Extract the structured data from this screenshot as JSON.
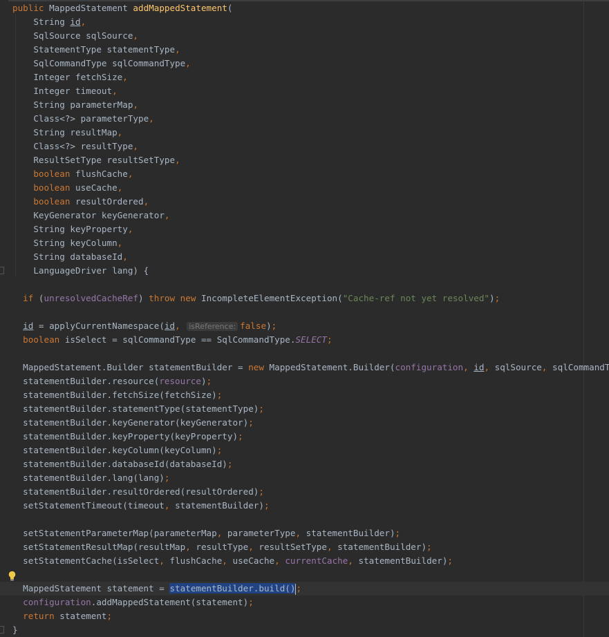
{
  "editor": {
    "lines": [
      {
        "indent": 0,
        "t": [
          [
            "kw",
            "public "
          ],
          [
            "",
            "MappedStatement "
          ],
          [
            "fn",
            "addMappedStatement"
          ],
          [
            "",
            "("
          ]
        ]
      },
      {
        "indent": 2,
        "t": [
          [
            "",
            "String "
          ],
          [
            "ul",
            "id"
          ],
          [
            "kw",
            ","
          ]
        ]
      },
      {
        "indent": 2,
        "t": [
          [
            "",
            "SqlSource sqlSource"
          ],
          [
            "kw",
            ","
          ]
        ]
      },
      {
        "indent": 2,
        "t": [
          [
            "",
            "StatementType statementType"
          ],
          [
            "kw",
            ","
          ]
        ]
      },
      {
        "indent": 2,
        "t": [
          [
            "",
            "SqlCommandType sqlCommandType"
          ],
          [
            "kw",
            ","
          ]
        ]
      },
      {
        "indent": 2,
        "t": [
          [
            "",
            "Integer fetchSize"
          ],
          [
            "kw",
            ","
          ]
        ]
      },
      {
        "indent": 2,
        "t": [
          [
            "",
            "Integer timeout"
          ],
          [
            "kw",
            ","
          ]
        ]
      },
      {
        "indent": 2,
        "t": [
          [
            "",
            "String parameterMap"
          ],
          [
            "kw",
            ","
          ]
        ]
      },
      {
        "indent": 2,
        "t": [
          [
            "",
            "Class<?> parameterType"
          ],
          [
            "kw",
            ","
          ]
        ]
      },
      {
        "indent": 2,
        "t": [
          [
            "",
            "String resultMap"
          ],
          [
            "kw",
            ","
          ]
        ]
      },
      {
        "indent": 2,
        "t": [
          [
            "",
            "Class<?> resultType"
          ],
          [
            "kw",
            ","
          ]
        ]
      },
      {
        "indent": 2,
        "t": [
          [
            "",
            "ResultSetType resultSetType"
          ],
          [
            "kw",
            ","
          ]
        ]
      },
      {
        "indent": 2,
        "t": [
          [
            "kw",
            "boolean "
          ],
          [
            "",
            "flushCache"
          ],
          [
            "kw",
            ","
          ]
        ]
      },
      {
        "indent": 2,
        "t": [
          [
            "kw",
            "boolean "
          ],
          [
            "",
            "useCache"
          ],
          [
            "kw",
            ","
          ]
        ]
      },
      {
        "indent": 2,
        "t": [
          [
            "kw",
            "boolean "
          ],
          [
            "",
            "resultOrdered"
          ],
          [
            "kw",
            ","
          ]
        ]
      },
      {
        "indent": 2,
        "t": [
          [
            "",
            "KeyGenerator keyGenerator"
          ],
          [
            "kw",
            ","
          ]
        ]
      },
      {
        "indent": 2,
        "t": [
          [
            "",
            "String keyProperty"
          ],
          [
            "kw",
            ","
          ]
        ]
      },
      {
        "indent": 2,
        "t": [
          [
            "",
            "String keyColumn"
          ],
          [
            "kw",
            ","
          ]
        ]
      },
      {
        "indent": 2,
        "t": [
          [
            "",
            "String databaseId"
          ],
          [
            "kw",
            ","
          ]
        ]
      },
      {
        "indent": 2,
        "t": [
          [
            "",
            "LanguageDriver lang) {"
          ]
        ]
      },
      {
        "indent": 0,
        "t": []
      },
      {
        "indent": 1,
        "t": [
          [
            "kw",
            "if "
          ],
          [
            "",
            "("
          ],
          [
            "fld",
            "unresolvedCacheRef"
          ],
          [
            "",
            ") "
          ],
          [
            "kw",
            "throw new "
          ],
          [
            "",
            "IncompleteElementException("
          ],
          [
            "str",
            "\"Cache-ref not yet resolved\""
          ],
          [
            "",
            ")"
          ],
          [
            "kw",
            ";"
          ]
        ]
      },
      {
        "indent": 0,
        "t": []
      },
      {
        "indent": 1,
        "t": [
          [
            "ul",
            "id"
          ],
          [
            "",
            " = applyCurrentNamespace("
          ],
          [
            "ul",
            "id"
          ],
          [
            "kw",
            ", "
          ],
          [
            "hint",
            "isReference:"
          ],
          [
            "kw",
            "false"
          ],
          [
            "",
            ")"
          ],
          [
            "kw",
            ";"
          ]
        ]
      },
      {
        "indent": 1,
        "t": [
          [
            "kw",
            "boolean "
          ],
          [
            "",
            "isSelect = sqlCommandType == SqlCommandType."
          ],
          [
            "stat",
            "SELECT"
          ],
          [
            "kw",
            ";"
          ]
        ]
      },
      {
        "indent": 0,
        "t": []
      },
      {
        "indent": 1,
        "t": [
          [
            "",
            "MappedStatement.Builder statementBuilder = "
          ],
          [
            "kw",
            "new "
          ],
          [
            "",
            "MappedStatement.Builder("
          ],
          [
            "fld",
            "configuration"
          ],
          [
            "kw",
            ", "
          ],
          [
            "ul",
            "id"
          ],
          [
            "kw",
            ", "
          ],
          [
            "",
            "sqlSource"
          ],
          [
            "kw",
            ", "
          ],
          [
            "",
            "sqlCommandType)"
          ],
          [
            "kw",
            ";"
          ]
        ]
      },
      {
        "indent": 1,
        "t": [
          [
            "",
            "statementBuilder.resource("
          ],
          [
            "fld",
            "resource"
          ],
          [
            "",
            ")"
          ],
          [
            "kw",
            ";"
          ]
        ]
      },
      {
        "indent": 1,
        "t": [
          [
            "",
            "statementBuilder.fetchSize(fetchSize)"
          ],
          [
            "kw",
            ";"
          ]
        ]
      },
      {
        "indent": 1,
        "t": [
          [
            "",
            "statementBuilder.statementType(statementType)"
          ],
          [
            "kw",
            ";"
          ]
        ]
      },
      {
        "indent": 1,
        "t": [
          [
            "",
            "statementBuilder.keyGenerator(keyGenerator)"
          ],
          [
            "kw",
            ";"
          ]
        ]
      },
      {
        "indent": 1,
        "t": [
          [
            "",
            "statementBuilder.keyProperty(keyProperty)"
          ],
          [
            "kw",
            ";"
          ]
        ]
      },
      {
        "indent": 1,
        "t": [
          [
            "",
            "statementBuilder.keyColumn(keyColumn)"
          ],
          [
            "kw",
            ";"
          ]
        ]
      },
      {
        "indent": 1,
        "t": [
          [
            "",
            "statementBuilder.databaseId(databaseId)"
          ],
          [
            "kw",
            ";"
          ]
        ]
      },
      {
        "indent": 1,
        "t": [
          [
            "",
            "statementBuilder.lang(lang)"
          ],
          [
            "kw",
            ";"
          ]
        ]
      },
      {
        "indent": 1,
        "t": [
          [
            "",
            "statementBuilder.resultOrdered(resultOrdered)"
          ],
          [
            "kw",
            ";"
          ]
        ]
      },
      {
        "indent": 1,
        "t": [
          [
            "",
            "setStatementTimeout(timeout"
          ],
          [
            "kw",
            ", "
          ],
          [
            "",
            "statementBuilder)"
          ],
          [
            "kw",
            ";"
          ]
        ]
      },
      {
        "indent": 0,
        "t": []
      },
      {
        "indent": 1,
        "t": [
          [
            "",
            "setStatementParameterMap(parameterMap"
          ],
          [
            "kw",
            ", "
          ],
          [
            "",
            "parameterType"
          ],
          [
            "kw",
            ", "
          ],
          [
            "",
            "statementBuilder)"
          ],
          [
            "kw",
            ";"
          ]
        ]
      },
      {
        "indent": 1,
        "t": [
          [
            "",
            "setStatementResultMap(resultMap"
          ],
          [
            "kw",
            ", "
          ],
          [
            "",
            "resultType"
          ],
          [
            "kw",
            ", "
          ],
          [
            "",
            "resultSetType"
          ],
          [
            "kw",
            ", "
          ],
          [
            "",
            "statementBuilder)"
          ],
          [
            "kw",
            ";"
          ]
        ]
      },
      {
        "indent": 1,
        "t": [
          [
            "",
            "setStatementCache(isSelect"
          ],
          [
            "kw",
            ", "
          ],
          [
            "",
            "flushCache"
          ],
          [
            "kw",
            ", "
          ],
          [
            "",
            "useCache"
          ],
          [
            "kw",
            ", "
          ],
          [
            "fld",
            "currentCache"
          ],
          [
            "kw",
            ", "
          ],
          [
            "",
            "statementBuilder)"
          ],
          [
            "kw",
            ";"
          ]
        ]
      },
      {
        "indent": 0,
        "t": []
      },
      {
        "indent": 1,
        "current": true,
        "t": [
          [
            "",
            "MappedStatement statement = "
          ],
          [
            "sel",
            "statementBuilder.build()"
          ],
          [
            "caret",
            ""
          ],
          [
            "kw",
            ";"
          ]
        ]
      },
      {
        "indent": 1,
        "t": [
          [
            "fld",
            "configuration"
          ],
          [
            "",
            ".addMappedStatement(statement)"
          ],
          [
            "kw",
            ";"
          ]
        ]
      },
      {
        "indent": 1,
        "t": [
          [
            "kw",
            "return "
          ],
          [
            "",
            "statement"
          ],
          [
            "kw",
            ";"
          ]
        ]
      },
      {
        "indent": 0,
        "t": [
          [
            "",
            "}"
          ]
        ]
      }
    ]
  },
  "gutter": {
    "fold_markers": [
      "method-start",
      "params-end",
      "method-end"
    ],
    "intention_icon": "lightbulb-icon"
  }
}
